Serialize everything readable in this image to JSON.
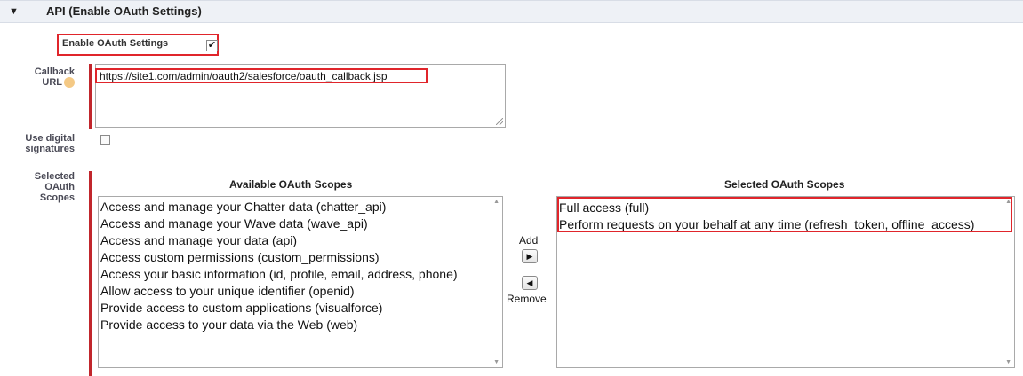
{
  "section": {
    "toggle_icon": "triangle-down-icon",
    "title": "API (Enable OAuth Settings)"
  },
  "enable_oauth": {
    "label": "Enable OAuth Settings",
    "checked": true,
    "check_glyph": "✔"
  },
  "callback_url": {
    "label_line1": "Callback",
    "label_line2": "URL",
    "value": "https://site1.com/admin/oauth2/salesforce/oauth_callback.jsp"
  },
  "digital_signatures": {
    "label_line1": "Use digital",
    "label_line2": "signatures",
    "checked": false
  },
  "scopes": {
    "label_line1": "Selected",
    "label_line2": "OAuth",
    "label_line3": "Scopes",
    "available_title": "Available OAuth Scopes",
    "selected_title": "Selected OAuth Scopes",
    "available": [
      "Access and manage your Chatter data (chatter_api)",
      "Access and manage your Wave data (wave_api)",
      "Access and manage your data (api)",
      "Access custom permissions (custom_permissions)",
      "Access your basic information (id, profile, email, address, phone)",
      "Allow access to your unique identifier (openid)",
      "Provide access to custom applications (visualforce)",
      "Provide access to your data via the Web (web)"
    ],
    "selected": [
      "Full access (full)",
      "Perform requests on your behalf at any time (refresh_token, offline_access)"
    ],
    "add_label": "Add",
    "remove_label": "Remove",
    "add_icon": "▶",
    "remove_icon": "◀"
  },
  "colors": {
    "highlight": "#e0252b",
    "required_bar": "#c1262c",
    "header_bg": "#eef1f6"
  }
}
